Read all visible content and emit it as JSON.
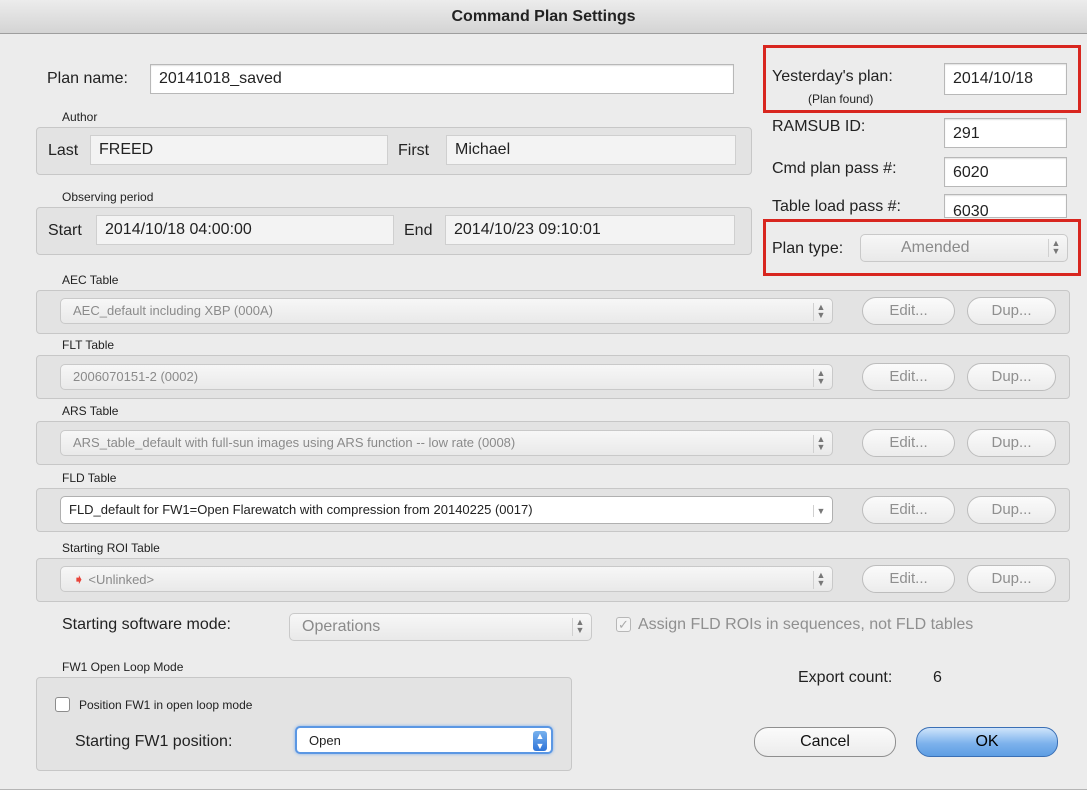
{
  "window": {
    "title": "Command Plan Settings"
  },
  "plan": {
    "name_label": "Plan name:",
    "name_value": "20141018_saved"
  },
  "author": {
    "group_label": "Author",
    "last_label": "Last",
    "last_value": "FREED",
    "first_label": "First",
    "first_value": "Michael"
  },
  "observing": {
    "group_label": "Observing period",
    "start_label": "Start",
    "start_value": "2014/10/18 04:00:00",
    "end_label": "End",
    "end_value": "2014/10/23 09:10:01"
  },
  "right_panel": {
    "yesterday_label": "Yesterday's plan:",
    "yesterday_value": "2014/10/18",
    "plan_found": "(Plan found)",
    "ramsub_label": "RAMSUB ID:",
    "ramsub_value": "291",
    "cmd_pass_label": "Cmd plan pass #:",
    "cmd_pass_value": "6020",
    "table_load_label": "Table load pass #:",
    "table_load_value": "6030",
    "plan_type_label": "Plan type:",
    "plan_type_value": "Amended"
  },
  "tables": [
    {
      "label": "AEC Table",
      "value": "AEC_default including XBP (000A)",
      "edit": "Edit...",
      "dup": "Dup..."
    },
    {
      "label": "FLT Table",
      "value": "2006070151-2 (0002)",
      "edit": "Edit...",
      "dup": "Dup..."
    },
    {
      "label": "ARS Table",
      "value": "ARS_table_default with full-sun images using ARS function -- low rate (0008)",
      "edit": "Edit...",
      "dup": "Dup..."
    },
    {
      "label": "FLD Table",
      "value": "FLD_default for FW1=Open Flarewatch with compression from 20140225 (0017)",
      "edit": "Edit...",
      "dup": "Dup..."
    },
    {
      "label": "Starting ROI Table",
      "value": "<Unlinked>",
      "edit": "Edit...",
      "dup": "Dup..."
    }
  ],
  "software_mode": {
    "label": "Starting software mode:",
    "value": "Operations"
  },
  "assign_fld": {
    "label": "Assign FLD ROIs in sequences, not FLD tables"
  },
  "fw1": {
    "group_label": "FW1 Open Loop Mode",
    "checkbox_label": "Position FW1 in open loop mode",
    "position_label": "Starting FW1 position:",
    "position_value": "Open"
  },
  "export": {
    "label": "Export count:",
    "value": "6"
  },
  "buttons": {
    "cancel": "Cancel",
    "ok": "OK"
  },
  "colors": {
    "highlight": "#d8261f",
    "default_button": "#5d9de3",
    "unlinked_icon": "#e8443a"
  }
}
